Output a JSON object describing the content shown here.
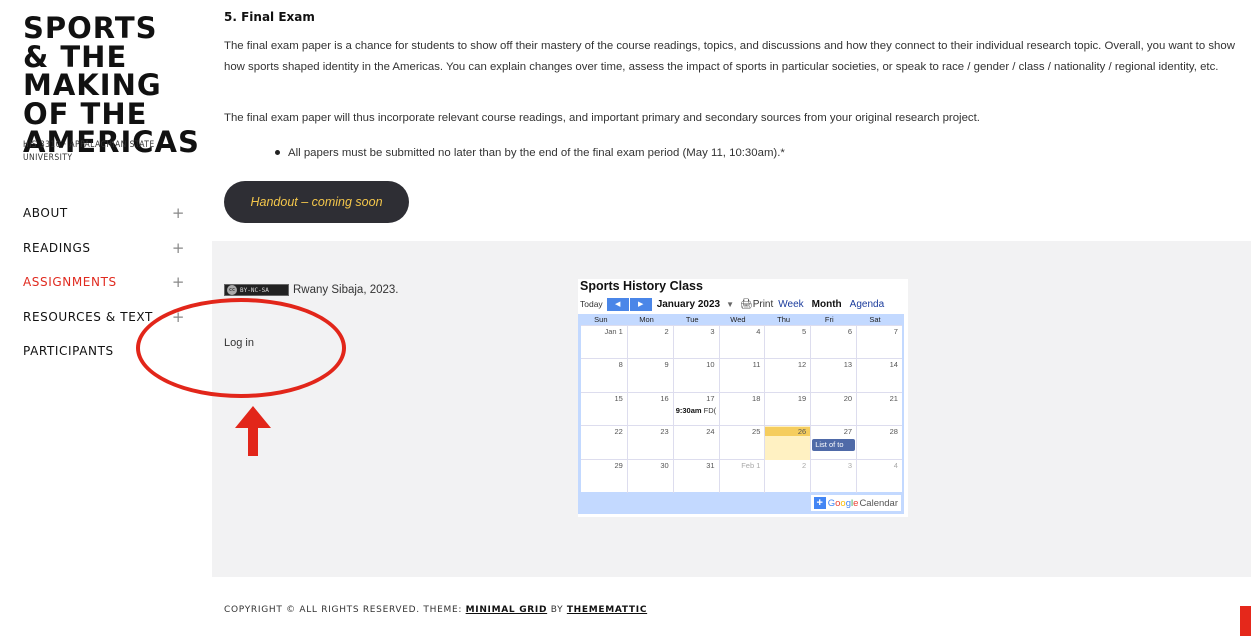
{
  "site": {
    "title": "SPORTS & THE MAKING OF THE AMERICAS",
    "description": "HIS 3310 · APPALACHIAN STATE UNIVERSITY"
  },
  "menu": {
    "items": [
      {
        "label": "ABOUT",
        "active": false,
        "has_plus": true
      },
      {
        "label": "READINGS",
        "active": false,
        "has_plus": true
      },
      {
        "label": "ASSIGNMENTS",
        "active": true,
        "has_plus": true
      },
      {
        "label": "RESOURCES & TEXT",
        "active": false,
        "has_plus": true
      },
      {
        "label": "PARTICIPANTS",
        "active": false,
        "has_plus": false
      }
    ],
    "plus_symbol": "+"
  },
  "content": {
    "section_title": "5. Final Exam",
    "para1": "The final exam paper is a chance for students to show off their mastery of the course readings, topics, and discussions and how they connect to their individual research topic. Overall, you want to show how sports shaped identity in the Americas. You can explain changes over time, assess the impact of sports in particular societies, or speak to race / gender / class / nationality / regional identity, etc.",
    "para2": "The final exam paper will thus incorporate relevant course readings, and important primary and secondary sources from your original research project.",
    "bullet": "All papers must be submitted no later than by the end of the final exam period (May 11, 10:30am).*",
    "handout_button": "Handout – coming soon"
  },
  "widgets": {
    "license_badge": "BY-NC-SA",
    "license_c": "cc",
    "attribution": "Rwany Sibaja, 2023.",
    "login": "Log in"
  },
  "calendar": {
    "title": "Sports History Class",
    "today": "Today",
    "prev": "◀",
    "next": "▶",
    "month_label": "January 2023",
    "caret": "▼",
    "print": "Print",
    "week_tab": "Week",
    "month_tab": "Month",
    "agenda_tab": "Agenda",
    "weekdays": [
      "Sun",
      "Mon",
      "Tue",
      "Wed",
      "Thu",
      "Fri",
      "Sat"
    ],
    "weeks": [
      [
        "Jan 1",
        "2",
        "3",
        "4",
        "5",
        "6",
        "7"
      ],
      [
        "8",
        "9",
        "10",
        "11",
        "12",
        "13",
        "14"
      ],
      [
        "15",
        "16",
        "17",
        "18",
        "19",
        "20",
        "21"
      ],
      [
        "22",
        "23",
        "24",
        "25",
        "26",
        "27",
        "28"
      ],
      [
        "29",
        "30",
        "31",
        "Feb 1",
        "2",
        "3",
        "4"
      ]
    ],
    "event_time": "9:30am",
    "event_text": "FD(",
    "chip_text": "List of to",
    "google_plus": "+",
    "google_word": [
      "G",
      "o",
      "o",
      "g",
      "l",
      "e"
    ],
    "calendar_word": "Calendar"
  },
  "footer": {
    "copyright_prefix": "COPYRIGHT © ALL RIGHTS RESERVED. THEME: ",
    "theme_link": "MINIMAL GRID",
    "by": " BY ",
    "author_link": "THEMEMATTIC"
  },
  "colors": {
    "accent_red": "#e02b20",
    "button_bg": "#2e2e34",
    "button_text": "#f3c64b",
    "annotation": "#e2261a"
  }
}
